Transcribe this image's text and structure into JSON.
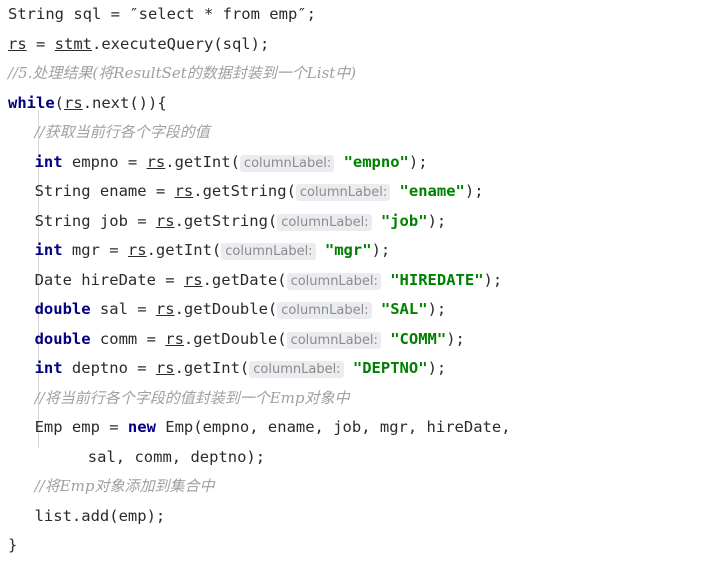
{
  "editor": {
    "language": "java",
    "colors": {
      "background": "#ffffff",
      "foreground": "#2b2b2b",
      "keyword": "#000080",
      "string": "#008000",
      "comment": "#a0a0a0",
      "hint_text": "#8c8c8c",
      "hint_background": "#ebecf0",
      "indent_guide": "#d8d8d8"
    },
    "hint_label": "columnLabel:",
    "lines": [
      {
        "id": "line-sql-declaration",
        "indent": 0,
        "tokens": [
          {
            "t": "plain",
            "v": "String sql = ″select * from emp″;"
          }
        ]
      },
      {
        "id": "line-execute-query",
        "indent": 0,
        "tokens": [
          {
            "t": "fld",
            "v": "rs"
          },
          {
            "t": "plain",
            "v": " = "
          },
          {
            "t": "fld",
            "v": "stmt"
          },
          {
            "t": "plain",
            "v": ".executeQuery(sql);"
          }
        ]
      },
      {
        "id": "line-comment-step5",
        "indent": 0,
        "tokens": [
          {
            "t": "cmt",
            "v": "//5.处理结果(将ResultSet的数据封装到一个List中)"
          }
        ]
      },
      {
        "id": "line-while-next",
        "indent": 0,
        "tokens": [
          {
            "t": "kw",
            "v": "while"
          },
          {
            "t": "plain",
            "v": "("
          },
          {
            "t": "fld",
            "v": "rs"
          },
          {
            "t": "plain",
            "v": ".next()){"
          }
        ]
      },
      {
        "id": "line-comment-get-fields",
        "indent": 1,
        "tokens": [
          {
            "t": "cmt",
            "v": "//获取当前行各个字段的值"
          }
        ]
      },
      {
        "id": "line-get-empno",
        "indent": 1,
        "tokens": [
          {
            "t": "kw",
            "v": "int"
          },
          {
            "t": "plain",
            "v": " empno = "
          },
          {
            "t": "fld",
            "v": "rs"
          },
          {
            "t": "plain",
            "v": ".getInt("
          },
          {
            "t": "hint",
            "v": "columnLabel:"
          },
          {
            "t": "str",
            "v": " \"empno\""
          },
          {
            "t": "plain",
            "v": ");"
          }
        ]
      },
      {
        "id": "line-get-ename",
        "indent": 1,
        "tokens": [
          {
            "t": "plain",
            "v": "String ename = "
          },
          {
            "t": "fld",
            "v": "rs"
          },
          {
            "t": "plain",
            "v": ".getString("
          },
          {
            "t": "hint",
            "v": "columnLabel:"
          },
          {
            "t": "str",
            "v": " \"ename\""
          },
          {
            "t": "plain",
            "v": ");"
          }
        ]
      },
      {
        "id": "line-get-job",
        "indent": 1,
        "tokens": [
          {
            "t": "plain",
            "v": "String job = "
          },
          {
            "t": "fld",
            "v": "rs"
          },
          {
            "t": "plain",
            "v": ".getString("
          },
          {
            "t": "hint",
            "v": "columnLabel:"
          },
          {
            "t": "str",
            "v": " \"job\""
          },
          {
            "t": "plain",
            "v": ");"
          }
        ]
      },
      {
        "id": "line-get-mgr",
        "indent": 1,
        "tokens": [
          {
            "t": "kw",
            "v": "int"
          },
          {
            "t": "plain",
            "v": " mgr = "
          },
          {
            "t": "fld",
            "v": "rs"
          },
          {
            "t": "plain",
            "v": ".getInt("
          },
          {
            "t": "hint",
            "v": "columnLabel:"
          },
          {
            "t": "str",
            "v": " \"mgr\""
          },
          {
            "t": "plain",
            "v": ");"
          }
        ]
      },
      {
        "id": "line-get-hiredate",
        "indent": 1,
        "tokens": [
          {
            "t": "plain",
            "v": "Date hireDate = "
          },
          {
            "t": "fld",
            "v": "rs"
          },
          {
            "t": "plain",
            "v": ".getDate("
          },
          {
            "t": "hint",
            "v": "columnLabel:"
          },
          {
            "t": "str",
            "v": " \"HIREDATE\""
          },
          {
            "t": "plain",
            "v": ");"
          }
        ]
      },
      {
        "id": "line-get-sal",
        "indent": 1,
        "tokens": [
          {
            "t": "kw",
            "v": "double"
          },
          {
            "t": "plain",
            "v": " sal = "
          },
          {
            "t": "fld",
            "v": "rs"
          },
          {
            "t": "plain",
            "v": ".getDouble("
          },
          {
            "t": "hint",
            "v": "columnLabel:"
          },
          {
            "t": "str",
            "v": " \"SAL\""
          },
          {
            "t": "plain",
            "v": ");"
          }
        ]
      },
      {
        "id": "line-get-comm",
        "indent": 1,
        "tokens": [
          {
            "t": "kw",
            "v": "double"
          },
          {
            "t": "plain",
            "v": " comm = "
          },
          {
            "t": "fld",
            "v": "rs"
          },
          {
            "t": "plain",
            "v": ".getDouble("
          },
          {
            "t": "hint",
            "v": "columnLabel:"
          },
          {
            "t": "str",
            "v": " \"COMM\""
          },
          {
            "t": "plain",
            "v": ");"
          }
        ]
      },
      {
        "id": "line-get-deptno",
        "indent": 1,
        "tokens": [
          {
            "t": "kw",
            "v": "int"
          },
          {
            "t": "plain",
            "v": " deptno = "
          },
          {
            "t": "fld",
            "v": "rs"
          },
          {
            "t": "plain",
            "v": ".getInt("
          },
          {
            "t": "hint",
            "v": "columnLabel:"
          },
          {
            "t": "str",
            "v": " \"DEPTNO\""
          },
          {
            "t": "plain",
            "v": ");"
          }
        ]
      },
      {
        "id": "line-comment-wrap-emp",
        "indent": 1,
        "tokens": [
          {
            "t": "cmt",
            "v": "//将当前行各个字段的值封装到一个Emp对象中"
          }
        ]
      },
      {
        "id": "line-new-emp",
        "indent": 1,
        "tokens": [
          {
            "t": "plain",
            "v": "Emp emp = "
          },
          {
            "t": "kw",
            "v": "new"
          },
          {
            "t": "plain",
            "v": " Emp(empno, ename, job, mgr, hireDate,"
          }
        ]
      },
      {
        "id": "line-new-emp-continued",
        "indent": 3,
        "tokens": [
          {
            "t": "plain",
            "v": "sal, comm, deptno);"
          }
        ]
      },
      {
        "id": "line-comment-add-to-list",
        "indent": 1,
        "tokens": [
          {
            "t": "cmt",
            "v": "//将Emp对象添加到集合中"
          }
        ]
      },
      {
        "id": "line-list-add",
        "indent": 1,
        "tokens": [
          {
            "t": "plain",
            "v": "list.add(emp);"
          }
        ]
      },
      {
        "id": "line-close-brace",
        "indent": 0,
        "tokens": [
          {
            "t": "plain",
            "v": "}"
          }
        ]
      }
    ]
  }
}
